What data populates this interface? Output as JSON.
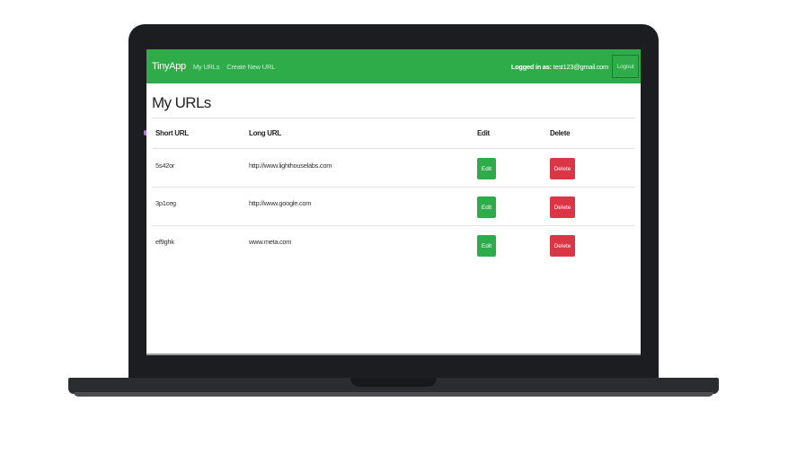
{
  "navbar": {
    "brand": "TinyApp",
    "links": [
      "My URLs",
      "Create New URL"
    ],
    "logged_in_label": "Logged in as:",
    "user_email": "test123@gmail.com",
    "logout_label": "Logout"
  },
  "page": {
    "title": "My URLs"
  },
  "table": {
    "headers": [
      "Short URL",
      "Long URL",
      "Edit",
      "Delete"
    ],
    "rows": [
      {
        "short": "5s42or",
        "long": "http://www.lighthouselabs.com",
        "edit": "Edit",
        "delete": "Delete"
      },
      {
        "short": "3p1ceg",
        "long": "http://www.google.com",
        "edit": "Edit",
        "delete": "Delete"
      },
      {
        "short": "ef9ghk",
        "long": "www.meta.com",
        "edit": "Edit",
        "delete": "Delete"
      }
    ]
  },
  "colors": {
    "primary": "#2eac4a",
    "danger": "#dc3545",
    "laptop": "#1c1d20"
  }
}
